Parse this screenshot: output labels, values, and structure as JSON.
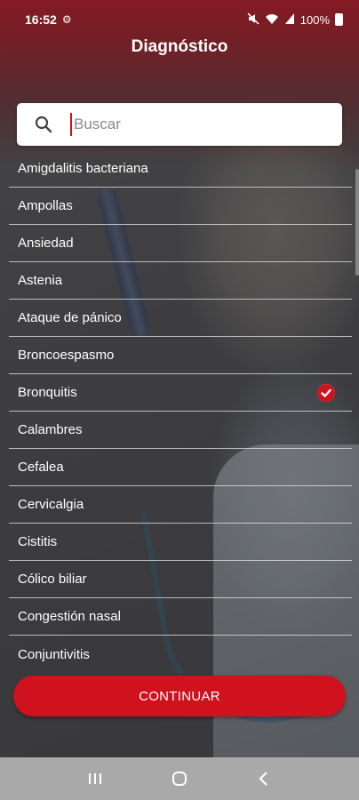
{
  "status": {
    "time": "16:52",
    "battery": "100%"
  },
  "header": {
    "title": "Diagnóstico"
  },
  "search": {
    "placeholder": "Buscar",
    "value": ""
  },
  "diagnoses": [
    {
      "label": "Amigdalitis bacteriana",
      "selected": false
    },
    {
      "label": "Ampollas",
      "selected": false
    },
    {
      "label": "Ansiedad",
      "selected": false
    },
    {
      "label": "Astenia",
      "selected": false
    },
    {
      "label": "Ataque de pánico",
      "selected": false
    },
    {
      "label": "Broncoespasmo",
      "selected": false
    },
    {
      "label": "Bronquitis",
      "selected": true
    },
    {
      "label": "Calambres",
      "selected": false
    },
    {
      "label": "Cefalea",
      "selected": false
    },
    {
      "label": "Cervicalgia",
      "selected": false
    },
    {
      "label": "Cistitis",
      "selected": false
    },
    {
      "label": "Cólico biliar",
      "selected": false
    },
    {
      "label": "Congestión nasal",
      "selected": false
    },
    {
      "label": "Conjuntivitis",
      "selected": false
    }
  ],
  "actions": {
    "continue_label": "CONTINUAR"
  },
  "icons": {
    "search": "search-icon",
    "selected": "check-circle-icon",
    "nav_recents": "recents-icon",
    "nav_home": "home-icon",
    "nav_back": "back-icon"
  },
  "colors": {
    "accent": "#d0111e"
  }
}
